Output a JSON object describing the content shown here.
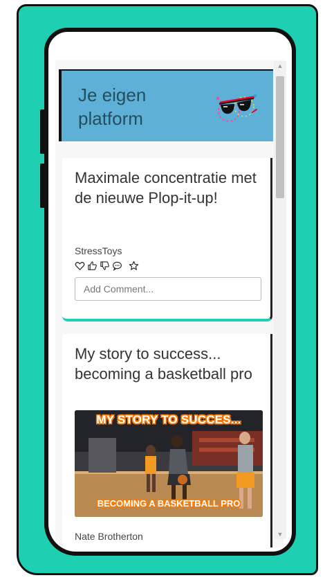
{
  "app": {
    "title": "Je eigen platform"
  },
  "posts": [
    {
      "title": "Maximale concentratie met de nieuwe Plop-it-up!",
      "author": "StressToys",
      "comment_placeholder": "Add Comment..."
    },
    {
      "title": "My story to success... becoming a basketball pro",
      "author": "Nate Brotherton",
      "image": {
        "top_text": "MY STORY TO SUCCES...",
        "bottom_text": "BECOMING A BASKETBALL PRO"
      }
    }
  ],
  "icons": {
    "logo": "sunglasses-icon",
    "actions": [
      "heart-icon",
      "thumbs-up-icon",
      "thumbs-down-icon",
      "comment-icon",
      "star-icon"
    ]
  },
  "colors": {
    "phone": "#1ecfb2",
    "header": "#5fb0d6",
    "header_text": "#244e5e",
    "card_accent": "#1ecfb2"
  }
}
